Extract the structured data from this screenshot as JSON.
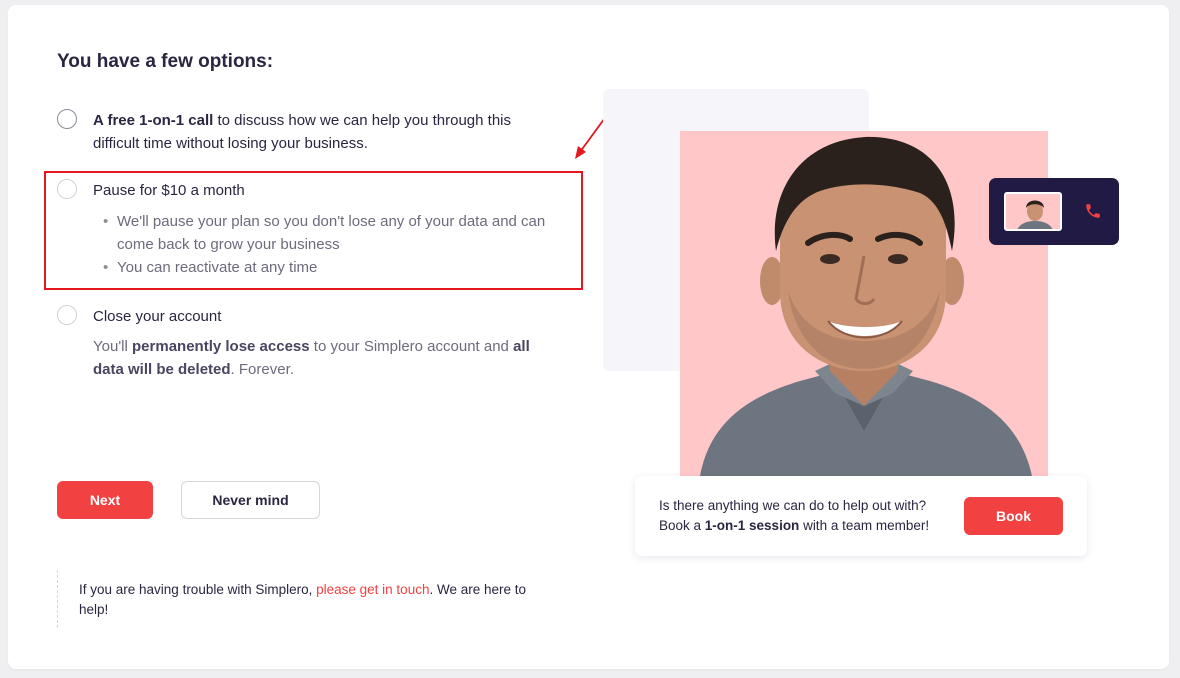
{
  "heading": "You have a few options:",
  "options": {
    "call": {
      "bold": "A free 1-on-1 call",
      "rest": " to discuss how we can help you through this difficult time without losing your business."
    },
    "pause": {
      "label": "Pause for $10 a month",
      "bullets": [
        "We'll pause your plan so you don't lose any of your data and can come back to grow your business",
        "You can reactivate at any time"
      ]
    },
    "close": {
      "label": "Close your account",
      "desc_1": "You'll ",
      "desc_bold_1": "permanently lose access",
      "desc_2": " to your Simplero account and ",
      "desc_bold_2": "all data will be deleted",
      "desc_3": ". Forever."
    }
  },
  "buttons": {
    "next": "Next",
    "never_mind": "Never mind",
    "book": "Book"
  },
  "help": {
    "prefix": "If you are having trouble with Simplero, ",
    "link": "please get in touch",
    "suffix": ". We are here to help!"
  },
  "help_card": {
    "line1": "Is there anything we can do to help out with?",
    "line2_prefix": "Book a ",
    "line2_bold": "1-on-1 session",
    "line2_suffix": " with a team member!"
  },
  "colors": {
    "accent": "#f24141",
    "highlight": "#e3171d",
    "photo_bg": "#ffc7c7",
    "call_card": "#211a44"
  }
}
